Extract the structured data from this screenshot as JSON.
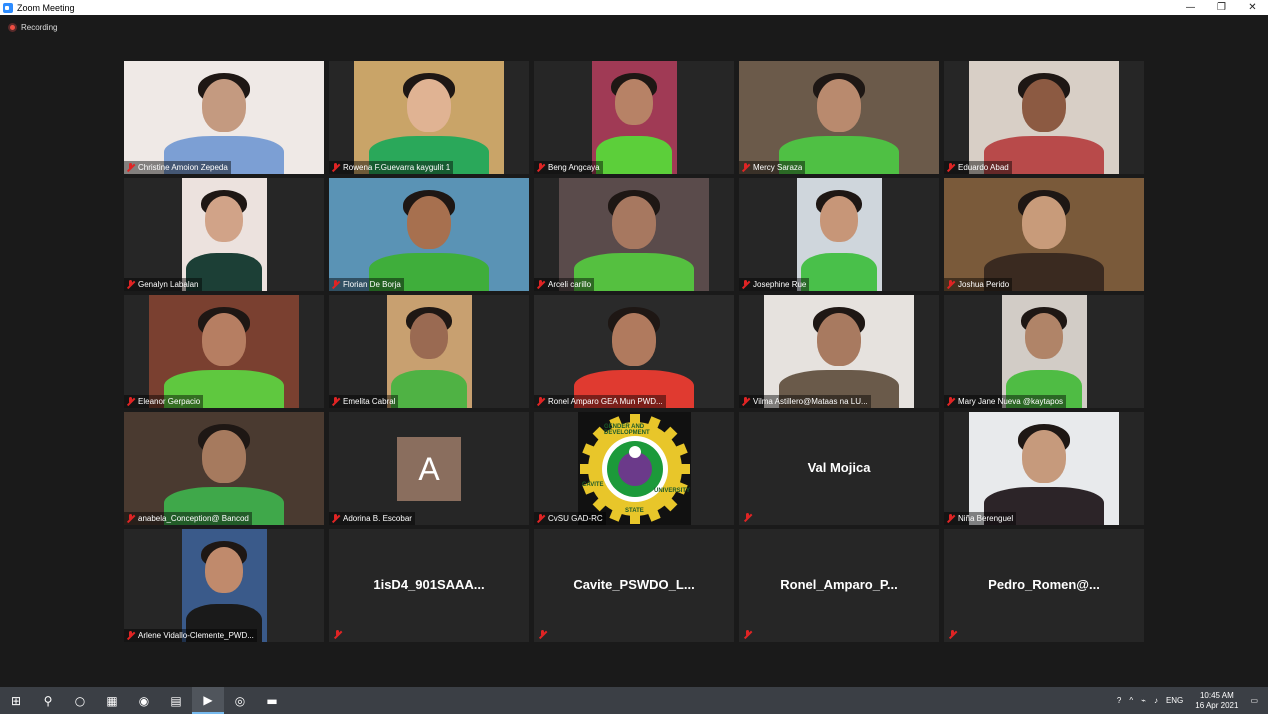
{
  "window": {
    "title": "Zoom Meeting",
    "controls": [
      "—",
      "❐",
      "✕"
    ]
  },
  "recording": {
    "label": "Recording"
  },
  "participants": [
    {
      "name": "Christine Amoion Zepeda",
      "video": true,
      "bg": "#efe9e6",
      "skin": "#c49a80",
      "shirt": "#7c9fd4"
    },
    {
      "name": "Rowena F.Guevarra kaygulit 1",
      "video": true,
      "bg": "#c9a468",
      "skin": "#e0b393",
      "shirt": "#2aa85a"
    },
    {
      "name": "Beng Angcaya",
      "video": true,
      "bg": "#a03a55",
      "skin": "#b78266",
      "shirt": "#5ccf3a"
    },
    {
      "name": "Mercy Saraza",
      "video": true,
      "bg": "#6b5a4a",
      "skin": "#b98a6e",
      "shirt": "#4fc044"
    },
    {
      "name": "Eduardo Abad",
      "video": true,
      "bg": "#d8cfc6",
      "skin": "#8c5a42",
      "shirt": "#b84a4a"
    },
    {
      "name": "Genalyn Labalan",
      "video": true,
      "bg": "#ece2de",
      "skin": "#d1a388",
      "shirt": "#1c3f36"
    },
    {
      "name": "Florian De Borja",
      "video": true,
      "bg": "#5a93b5",
      "skin": "#a7704f",
      "shirt": "#3fae3b"
    },
    {
      "name": "Arceli carillo",
      "video": true,
      "bg": "#5a4b4b",
      "skin": "#a77860",
      "shirt": "#55c040"
    },
    {
      "name": "Josephine Rue",
      "video": true,
      "bg": "#cfd6dc",
      "skin": "#c79678",
      "shirt": "#49c04a"
    },
    {
      "name": "Joshua Perido",
      "video": true,
      "bg": "#7a5a3a",
      "skin": "#c89b7a",
      "shirt": "#3a2a20"
    },
    {
      "name": "Eleanor Gerpacio",
      "video": true,
      "bg": "#7a4030",
      "skin": "#b67e62",
      "shirt": "#5fc83f"
    },
    {
      "name": "Emelita Cabral",
      "video": true,
      "bg": "#c8a070",
      "skin": "#9a6a52",
      "shirt": "#4fb244"
    },
    {
      "name": "Ronel Amparo GEA Mun PWD...",
      "video": true,
      "bg": "#2a2a2a",
      "skin": "#b07a5e",
      "shirt": "#e03a30"
    },
    {
      "name": "Vilma Astillero@Mataas na LU...",
      "video": true,
      "bg": "#e6e2de",
      "skin": "#a87a60",
      "shirt": "#6a5a4a"
    },
    {
      "name": "Mary Jane Nueva @kaytapos",
      "video": true,
      "bg": "#d2ccc6",
      "skin": "#b08468",
      "shirt": "#4fbc44"
    },
    {
      "name": "anabela_Conception@ Bancod",
      "video": true,
      "bg": "#4a3a30",
      "skin": "#a67a5e",
      "shirt": "#3fa84a"
    },
    {
      "name": "Adorina B. Escobar",
      "video": false,
      "avatar": "A"
    },
    {
      "name": "CvSU GAD-RC",
      "video": "logo"
    },
    {
      "name": "Val Mojica",
      "video": false,
      "center": true
    },
    {
      "name": "Niña Berenguel",
      "video": true,
      "bg": "#e8eaec",
      "skin": "#c69a7c",
      "shirt": "#2c2428"
    },
    {
      "name": "Arlene Vidallo-Clemente_PWD...",
      "video": true,
      "bg": "#3a5a8a",
      "skin": "#c08a6c",
      "shirt": "#1a1a1a"
    },
    {
      "name": "1isD4_901SAAA...",
      "video": false,
      "center": true
    },
    {
      "name": "Cavite_PSWDO_L...",
      "video": false,
      "center": true
    },
    {
      "name": "Ronel_Amparo_P...",
      "video": false,
      "center": true
    },
    {
      "name": "Pedro_Romen@...",
      "video": false,
      "center": true
    }
  ],
  "logo": {
    "top_text": "GENDER AND DEVELOPMENT",
    "left_text": "CAVITE",
    "bottom_text": "STATE",
    "right_text": "UNIVERSITY",
    "ring": "#e8c62a",
    "inner": "#1c9a3a"
  },
  "taskbar": {
    "items": [
      {
        "icon": "windows-start-icon",
        "glyph": "⊞"
      },
      {
        "icon": "search-icon",
        "glyph": "⚲"
      },
      {
        "icon": "cortana-icon",
        "glyph": "○"
      },
      {
        "icon": "calculator-icon",
        "glyph": "▦"
      },
      {
        "icon": "obs-icon",
        "glyph": "◉"
      },
      {
        "icon": "remote-desktop-icon",
        "glyph": "▤"
      },
      {
        "icon": "zoom-icon",
        "glyph": "▶"
      },
      {
        "icon": "chrome-icon",
        "glyph": "◎"
      },
      {
        "icon": "file-explorer-icon",
        "glyph": "▬"
      }
    ],
    "language": "ENG",
    "time": "10:45 AM",
    "date": "16 Apr 2021"
  }
}
